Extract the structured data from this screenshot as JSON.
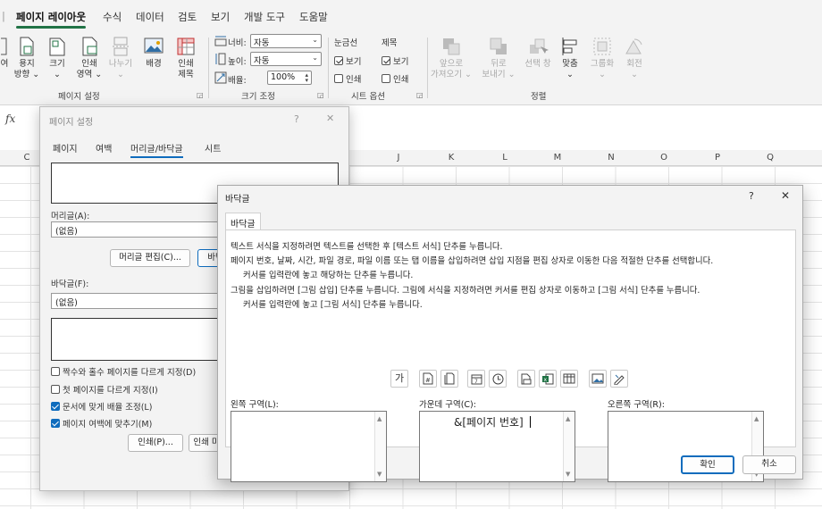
{
  "ribbon": {
    "tabs": [
      "페이지 레이아웃",
      "수식",
      "데이터",
      "검토",
      "보기",
      "개발 도구",
      "도움말"
    ],
    "active_tab": "페이지 레이아웃",
    "page_setup": {
      "btn_margins_partial_l1": "여",
      "btn_margins_partial_l2": "",
      "btn_orientation_l1": "용지",
      "btn_orientation_l2": "방향 ⌄",
      "btn_size_l1": "크기",
      "btn_size_l2": "⌄",
      "btn_print_area_l1": "인쇄",
      "btn_print_area_l2": "영역 ⌄",
      "btn_breaks_l1": "나누기",
      "btn_breaks_l2": "⌄",
      "btn_background": "배경",
      "btn_print_titles_l1": "인쇄",
      "btn_print_titles_l2": "제목",
      "group_label": "페이지 설정"
    },
    "scale": {
      "width_label": "너비:",
      "width_value": "자동",
      "height_label": "높이:",
      "height_value": "자동",
      "scale_label": "배율:",
      "scale_value": "100%",
      "group_label": "크기 조정"
    },
    "sheet_options": {
      "gridlines_label": "눈금선",
      "headings_label": "제목",
      "view_label": "보기",
      "print_label": "인쇄",
      "group_label": "시트 옵션"
    },
    "arrange": {
      "bring_forward_l1": "앞으로",
      "bring_forward_l2": "가져오기 ⌄",
      "send_backward_l1": "뒤로",
      "send_backward_l2": "보내기 ⌄",
      "selection_pane": "선택 창",
      "align_l1": "맞춤",
      "align_l2": "⌄",
      "group_l1": "그룹화",
      "group_l2": "⌄",
      "rotate_l1": "회전",
      "rotate_l2": "⌄",
      "group_label": "정렬"
    }
  },
  "formula_bar": {
    "fx": "fx"
  },
  "columns": [
    "C",
    "J",
    "K",
    "L",
    "M",
    "N",
    "O",
    "P",
    "Q"
  ],
  "page_setup_dialog": {
    "title": "페이지 설정",
    "help": "?",
    "close": "✕",
    "tabs": [
      "페이지",
      "여백",
      "머리글/바닥글",
      "시트"
    ],
    "header_label": "머리글(A):",
    "header_value": "(없음)",
    "custom_header_btn": "머리글 편집(C)...",
    "custom_footer_btn_partial": "바닥",
    "footer_label": "바닥글(F):",
    "footer_value": "(없음)",
    "checkboxes": [
      {
        "label": "짝수와 홀수 페이지를 다르게 지정(D)",
        "checked": false
      },
      {
        "label": "첫 페이지를 다르게 지정(I)",
        "checked": false
      },
      {
        "label": "문서에 맞게 배율 조정(L)",
        "checked": true
      },
      {
        "label": "페이지 여백에 맞추기(M)",
        "checked": true
      }
    ],
    "print_btn": "인쇄(P)...",
    "print_preview_partial": "인쇄 미"
  },
  "footer_dialog": {
    "title": "바닥글",
    "help": "?",
    "close": "✕",
    "tab": "바닥글",
    "instructions": [
      "텍스트 서식을 지정하려면 텍스트를 선택한 후 [텍스트 서식] 단추를 누릅니다.",
      "페이지 번호, 날짜, 시간, 파일 경로, 파일 이름 또는 탭 이름을 삽입하려면 삽입 지점을 편집 상자로 이동한 다음 적절한 단추를 선택합니다.",
      "커서를 입력란에 놓고 해당하는 단추를 누릅니다.",
      "그림을 삽입하려면 [그림 삽입] 단추를 누릅니다. 그림에 서식을 지정하려면 커서를 편집 상자로 이동하고 [그림 서식] 단추를 누릅니다.",
      "커서를 입력란에 놓고 [그림 서식] 단추를 누릅니다."
    ],
    "format_text_btn": "가",
    "left_label": "왼쪽 구역(L):",
    "center_label": "가운데 구역(C):",
    "right_label": "오른쪽 구역(R):",
    "left_value": "",
    "center_value": "&[페이지 번호]",
    "right_value": "",
    "ok_btn": "확인",
    "cancel_btn": "취소"
  }
}
